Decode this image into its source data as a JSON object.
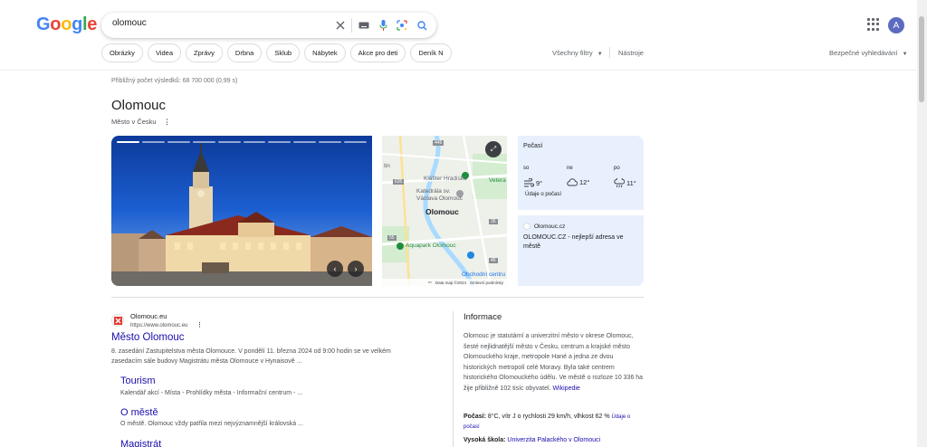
{
  "header": {
    "logo_text": "Google",
    "search_value": "olomouc",
    "avatar_letter": "A"
  },
  "chips": [
    "Obrázky",
    "Videa",
    "Zprávy",
    "Drbna",
    "Sklub",
    "Nábytek",
    "Akce pro deti",
    "Deník N"
  ],
  "toolbar": {
    "all_filters": "Všechny filtry",
    "tools": "Nástroje",
    "safe_search": "Bezpečné vyhledávání"
  },
  "stats": "Přibližný počet výsledků: 68 700 000 (0,99 s)",
  "knowledge_panel": {
    "title": "Olomouc",
    "subtitle": "Město v Česku"
  },
  "map": {
    "labels": [
      "Klášter Hradisko",
      "Katedrála sv. Václava Olomouc",
      "Aquapark Olomouc",
      "Obchodní centru",
      "Vetera",
      "tin"
    ],
    "city": "Olomouc",
    "road_numbers": [
      "446",
      "635",
      "35",
      "55",
      "46"
    ],
    "footer": [
      "Data map ©2024",
      "Smluvní podmínky"
    ]
  },
  "weather": {
    "title": "Počasí",
    "days": [
      {
        "day": "so",
        "temp": "9°",
        "icon": "wind-icon"
      },
      {
        "day": "ne",
        "temp": "12°",
        "icon": "cloud-icon"
      },
      {
        "day": "po",
        "temp": "11°",
        "icon": "rain-icon"
      }
    ],
    "link": "Údaje o počasí"
  },
  "site_card": {
    "domain": "Olomouc.cz",
    "text": "OLOMOUC.CZ - nejlepší adresa ve městě"
  },
  "result": {
    "site_name": "Olomouc.eu",
    "url": "https://www.olomouc.eu",
    "title": "Město Olomouc",
    "snippet": "8. zasedání Zastupitelstva města Olomouce. V pondělí 11. března 2024 od 9:00 hodin se ve velkém zasedacím sále budovy Magistrátu města Olomouce v Hynaisově ...",
    "sublinks": [
      {
        "title": "Tourism",
        "snippet": "Kalendář akcí - Místa - Prohlídky města - Informační centrum - ..."
      },
      {
        "title": "O městě",
        "snippet": "O městě. Olomouc vždy patřila mezi nejvýznamnější královská ..."
      },
      {
        "title": "Magistrát",
        "snippet": ""
      }
    ]
  },
  "info": {
    "heading": "Informace",
    "text": "Olomouc je statutární a univerzitní město v okrese Olomouc, šesté nejlidnatější město v Česku, centrum a krajské město Olomouckého kraje, metropole Hané a jedna ze dvou historických metropolí celé Moravy. Byla také centrem historického Olomouckého údělu. Ve městě o rozloze 10 336 ha žije přibližně 102 tisíc obyvatel.",
    "wiki": "Wikipedie",
    "weather_label": "Počasí:",
    "weather_value": "8°C, vítr J o rychlosti 29 km/h, vlhkost 62 %",
    "weather_link": "Údaje o počasí",
    "uni_label": "Vysoká škola:",
    "uni_value": "Univerzita Palackého v Olomouci"
  },
  "colors": {
    "link": "#1a0dab",
    "card_bg": "#e8f0fe",
    "google_blue": "#4285f4",
    "google_red": "#ea4335",
    "google_yellow": "#fbbc05",
    "google_green": "#34a853"
  }
}
